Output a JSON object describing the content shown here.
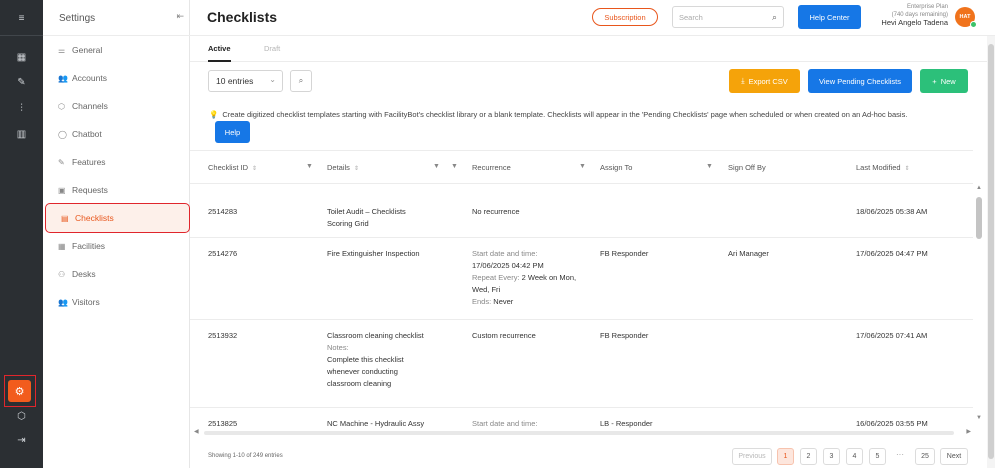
{
  "settings": {
    "title": "Settings",
    "items": [
      {
        "label": "General",
        "icon": "sliders-icon"
      },
      {
        "label": "Accounts",
        "icon": "users-icon"
      },
      {
        "label": "Channels",
        "icon": "cube-icon"
      },
      {
        "label": "Chatbot",
        "icon": "chat-icon"
      },
      {
        "label": "Features",
        "icon": "pin-icon"
      },
      {
        "label": "Requests",
        "icon": "inbox-icon"
      },
      {
        "label": "Checklists",
        "icon": "clipboard-icon"
      },
      {
        "label": "Facilities",
        "icon": "calendar-icon"
      },
      {
        "label": "Desks",
        "icon": "person-icon"
      },
      {
        "label": "Visitors",
        "icon": "visitors-icon"
      }
    ]
  },
  "header": {
    "title": "Checklists",
    "subscription": "Subscription",
    "search_placeholder": "Search",
    "help_center": "Help Center",
    "plan": "Enterprise Plan",
    "days_remaining": "(740 days remaining)",
    "user_name": "Hevi Angelo Tadena",
    "avatar_initials": "HAT"
  },
  "tabs": {
    "active": "Active",
    "draft": "Draft"
  },
  "toolbar": {
    "entries": "10 entries",
    "export_csv": "Export CSV",
    "view_pending": "View Pending Checklists",
    "new": "New"
  },
  "note": {
    "text": "Create digitized checklist templates starting with FacilityBot's checklist library or a blank template. Checklists will appear in the 'Pending Checklists' page when scheduled or when created on an Ad-hoc basis.",
    "help": "Help"
  },
  "table": {
    "headers": {
      "id": "Checklist ID",
      "details": "Details",
      "recurrence": "Recurrence",
      "assign": "Assign To",
      "signoff": "Sign Off By",
      "modified": "Last Modified"
    },
    "rows": [
      {
        "id": "2514283",
        "details": [
          "Toilet Audit – Checklists",
          "Scoring Grid"
        ],
        "recurrence": "No recurrence",
        "assign": "",
        "signoff": "",
        "modified": "18/06/2025 05:38 AM"
      },
      {
        "id": "2514276",
        "details": [
          "Fire Extinguisher Inspection"
        ],
        "rec_start_label": "Start date and time:",
        "rec_start": "17/06/2025 04:42 PM",
        "rec_repeat_label": "Repeat Every:",
        "rec_repeat": "2 Week on Mon,",
        "rec_repeat2": "Wed, Fri",
        "rec_ends_label": "Ends:",
        "rec_ends": "Never",
        "assign": "FB Responder",
        "signoff": "Ari Manager",
        "modified": "17/06/2025 04:47 PM"
      },
      {
        "id": "2513932",
        "details_title": "Classroom cleaning checklist",
        "details_notes_label": "Notes:",
        "details_notes": [
          "Complete this checklist",
          "whenever conducting",
          "classroom cleaning"
        ],
        "recurrence": "Custom recurrence",
        "assign": "FB Responder",
        "signoff": "",
        "modified": "17/06/2025 07:41 AM"
      },
      {
        "id": "2513825",
        "details": [
          "NC Machine - Hydraulic Assy"
        ],
        "recurrence": "Start date and time:",
        "assign": "LB - Responder",
        "signoff": "",
        "modified": "16/06/2025 03:55 PM"
      }
    ]
  },
  "footer": {
    "showing": "Showing 1-10 of 249 entries",
    "previous": "Previous",
    "pages": [
      "1",
      "2",
      "3",
      "4",
      "5"
    ],
    "ellipsis": "···",
    "last": "25",
    "next": "Next"
  }
}
